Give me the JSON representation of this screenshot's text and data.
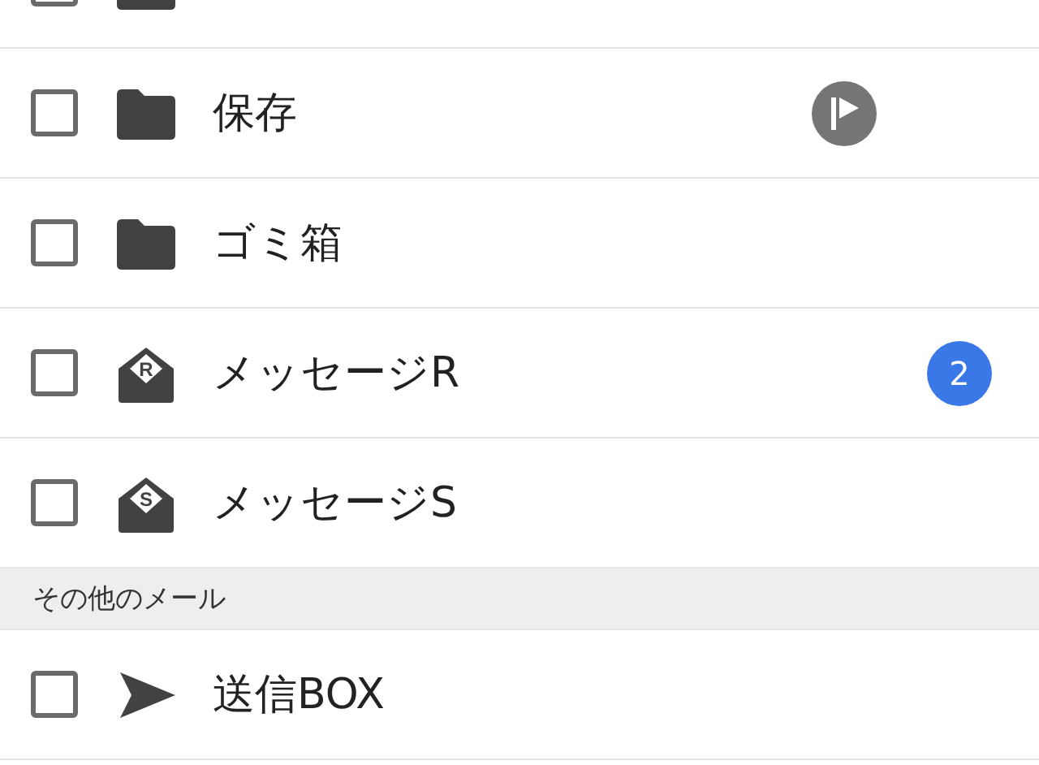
{
  "sections": [
    {
      "rows": [
        {
          "kind": "folder",
          "checked": false,
          "partial": true
        },
        {
          "kind": "folder",
          "label": "保存",
          "checked": false,
          "badge": {
            "kind": "flag"
          }
        },
        {
          "kind": "folder",
          "label": "ゴミ箱",
          "checked": false
        },
        {
          "kind": "mail",
          "icon_letter": "R",
          "label": "メッセージR",
          "checked": false,
          "badge": {
            "kind": "count",
            "text": "2"
          }
        },
        {
          "kind": "mail",
          "icon_letter": "S",
          "label": "メッセージS",
          "checked": false
        }
      ]
    },
    {
      "header": "その他のメール",
      "rows": [
        {
          "kind": "send",
          "label": "送信BOX",
          "checked": false
        }
      ]
    }
  ]
}
